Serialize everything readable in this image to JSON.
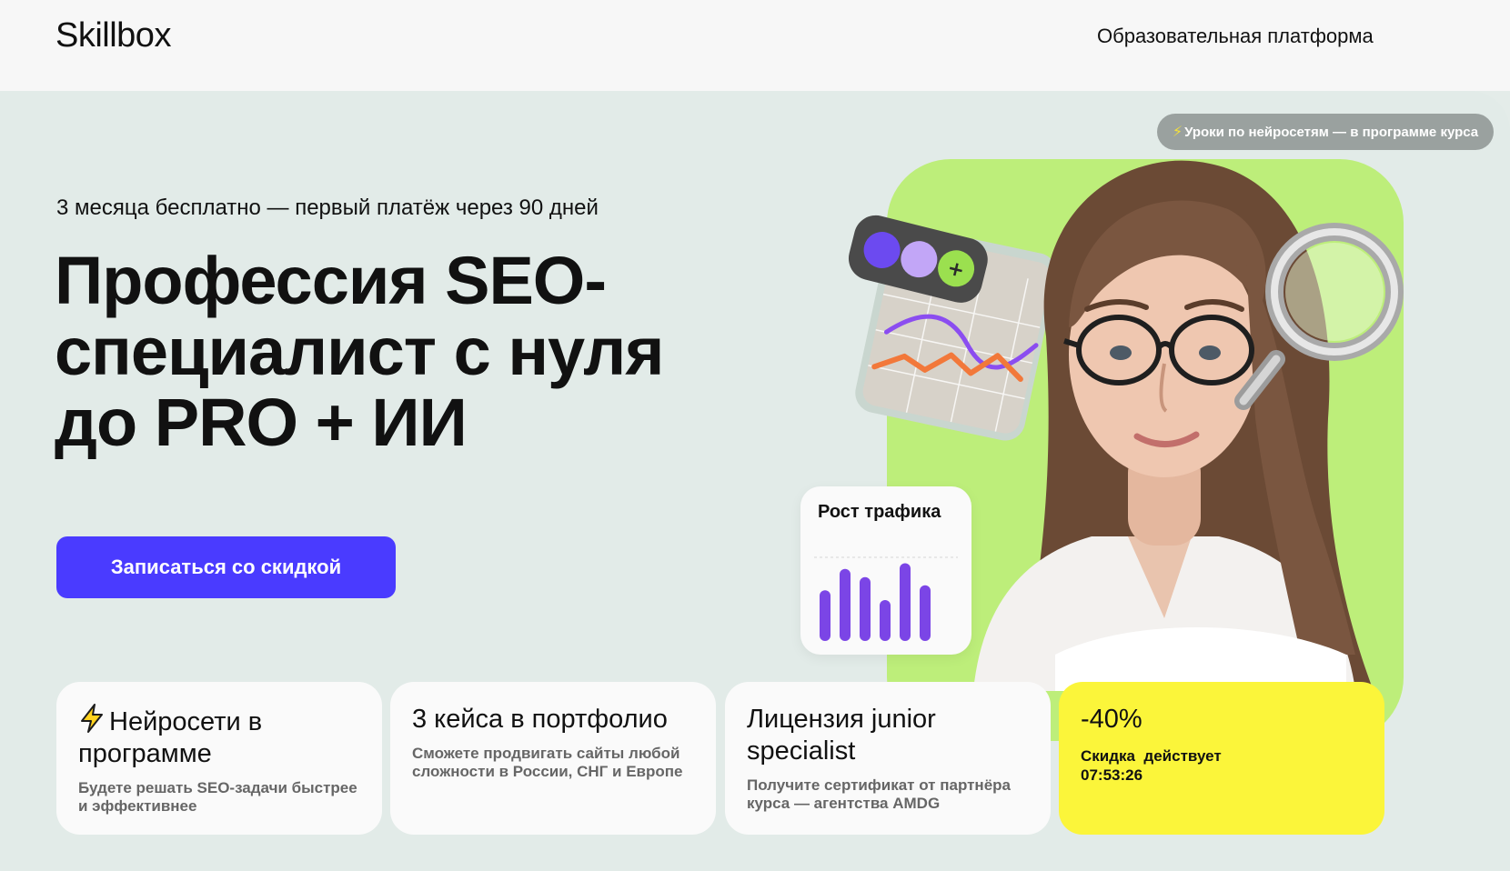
{
  "header": {
    "logo": "Skillbox",
    "platform_link": "Образовательная платформа"
  },
  "badge": {
    "icon": "bolt-icon",
    "text": "Уроки по нейросетям — в программе курса"
  },
  "hero": {
    "pretitle": "3 месяца бесплатно — первый платёж через 90 дней",
    "title": "Профессия SEO-специалист с нуля до PRO + ИИ",
    "cta_label": "Записаться со скидкой"
  },
  "traffic_card": {
    "label": "Рост трафика",
    "bars": [
      0.62,
      0.88,
      0.78,
      0.5,
      0.95,
      0.68
    ]
  },
  "cards": [
    {
      "icon": "bolt-icon",
      "title": "Нейросети в программе",
      "desc": "Будете решать SEO-задачи быстрее и эффективнее"
    },
    {
      "title": "3 кейса в портфолио",
      "desc": "Сможете продвигать сайты любой сложности в России, СНГ и Европе"
    },
    {
      "title": "Лицензия junior specialist",
      "desc": "Получите сертификат от партнёра курса — агентства AMDG"
    }
  ],
  "discount": {
    "percent": "-40%",
    "label": "Скидка  действует",
    "timer": "07:53:26"
  },
  "colors": {
    "accent": "#4a3bff",
    "green": "#bdee7a",
    "yellow": "#fbf53a",
    "background": "#e2ebe8",
    "bars": "#7b45e6"
  }
}
